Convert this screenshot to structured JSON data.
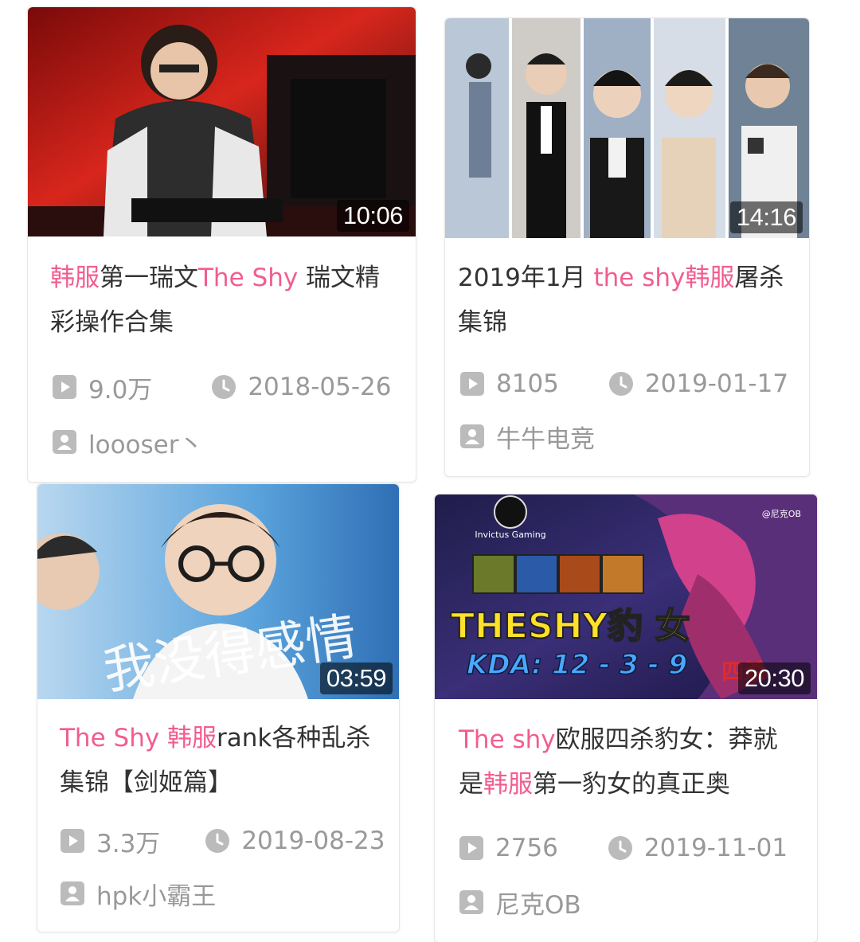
{
  "colors": {
    "highlight": "#f25d8e",
    "title_text": "#333333",
    "meta_text": "#999999",
    "icon": "#bbbbbb"
  },
  "videos": [
    {
      "thumbnail": "player-in-red-arena",
      "duration": "10:06",
      "title_parts": [
        {
          "text": "韩服",
          "highlight": true
        },
        {
          "text": "第一瑞文",
          "highlight": false
        },
        {
          "text": "The Shy",
          "highlight": true
        },
        {
          "text": " 瑞文精彩操作合集",
          "highlight": false
        }
      ],
      "views": "9.0万",
      "date": "2018-05-26",
      "author": "loooser丶"
    },
    {
      "thumbnail": "five-photo-collage",
      "duration": "14:16",
      "title_parts": [
        {
          "text": "2019年1月 ",
          "highlight": false
        },
        {
          "text": "the shy",
          "highlight": true
        },
        {
          "text": "韩服",
          "highlight": true
        },
        {
          "text": "屠杀集锦",
          "highlight": false
        }
      ],
      "views": "8105",
      "date": "2019-01-17",
      "author": "牛牛电竞"
    },
    {
      "thumbnail": "player-with-glasses-blue",
      "thumbnail_caption": "我没得感情",
      "duration": "03:59",
      "title_parts": [
        {
          "text": "The Shy ",
          "highlight": true
        },
        {
          "text": "韩服",
          "highlight": true
        },
        {
          "text": "rank各种乱杀集锦【剑姬篇】",
          "highlight": false
        }
      ],
      "views": "3.3万",
      "date": "2019-08-23",
      "author": "hpk小霸王"
    },
    {
      "thumbnail": "game-champion-art",
      "thumbnail_caption": "THESHY豹 女",
      "thumbnail_kda": "KDA: 12 - 3 - 9",
      "thumbnail_badge": "四杀",
      "thumbnail_team": "Invictus Gaming",
      "thumbnail_watermark": "@尼克OB",
      "duration": "20:30",
      "title_parts": [
        {
          "text": "The shy",
          "highlight": true
        },
        {
          "text": "欧服四杀豹女：莽就是",
          "highlight": false
        },
        {
          "text": "韩服",
          "highlight": true
        },
        {
          "text": "第一豹女的真正奥",
          "highlight": false
        }
      ],
      "views": "2756",
      "date": "2019-11-01",
      "author": "尼克OB"
    }
  ]
}
